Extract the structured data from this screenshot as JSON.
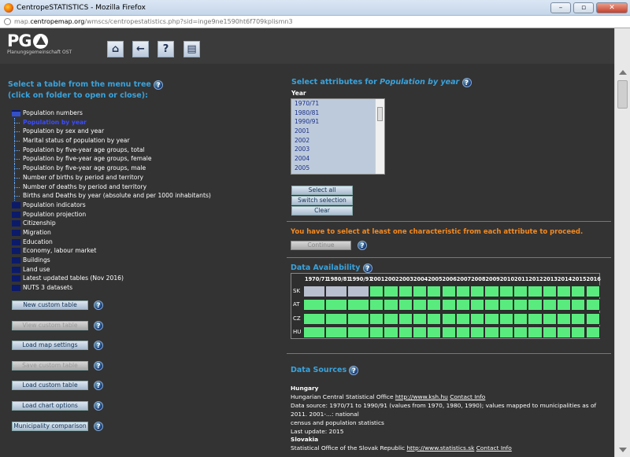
{
  "window": {
    "title": "CentropeSTATISTICS - Mozilla Firefox",
    "url_prefix": "map.",
    "url_domain": "centropemap.org",
    "url_path": "/wmscs/centropestatistics.php?sid=inge9ne1590ht6f709kplismn3"
  },
  "logo": {
    "text": "PG",
    "subtitle": "Planungsgemeinschaft OST"
  },
  "toolbar": {
    "home": "⌂",
    "back": "←",
    "help": "?",
    "window": "▤"
  },
  "left": {
    "heading1": "Select a table from the menu tree",
    "heading2": "(click on folder to open or close):",
    "tree": [
      {
        "label": "Population numbers",
        "type": "folder-open"
      },
      {
        "label": "Population by year",
        "type": "leaf",
        "selected": true
      },
      {
        "label": "Population by sex and year",
        "type": "leaf"
      },
      {
        "label": "Marital status of population by year",
        "type": "leaf"
      },
      {
        "label": "Population by five-year age groups, total",
        "type": "leaf"
      },
      {
        "label": "Population by five-year age groups, female",
        "type": "leaf"
      },
      {
        "label": "Population by five-year age groups, male",
        "type": "leaf"
      },
      {
        "label": "Number of births by period and territory",
        "type": "leaf"
      },
      {
        "label": "Number of deaths by period and territory",
        "type": "leaf"
      },
      {
        "label": "Births and Deaths by year (absolute and per 1000 inhabitants)",
        "type": "leaf"
      },
      {
        "label": "Population indicators",
        "type": "folder"
      },
      {
        "label": "Population projection",
        "type": "folder"
      },
      {
        "label": "Citizenship",
        "type": "folder"
      },
      {
        "label": "Migration",
        "type": "folder"
      },
      {
        "label": "Education",
        "type": "folder"
      },
      {
        "label": "Economy, labour market",
        "type": "folder"
      },
      {
        "label": "Buildings",
        "type": "folder"
      },
      {
        "label": "Land use",
        "type": "folder"
      },
      {
        "label": "Latest updated tables (Nov 2016)",
        "type": "folder"
      },
      {
        "label": "NUTS 3 datasets",
        "type": "folder"
      }
    ],
    "buttons": [
      {
        "label": "New custom table",
        "disabled": false
      },
      {
        "label": "View custom table",
        "disabled": true
      },
      {
        "label": "Load map settings",
        "disabled": false
      },
      {
        "label": "Save custom table",
        "disabled": true
      },
      {
        "label": "Load custom table",
        "disabled": false
      },
      {
        "label": "Load chart options",
        "disabled": false
      },
      {
        "label": "Municipality comparison",
        "disabled": false
      }
    ]
  },
  "right": {
    "heading_prefix": "Select attributes for ",
    "heading_table": "Population by year",
    "year_label": "Year",
    "years": [
      "1970/71",
      "1980/81",
      "1990/91",
      "2001",
      "2002",
      "2003",
      "2004",
      "2005"
    ],
    "select_all": "Select all",
    "switch_selection": "Switch selection",
    "clear": "Clear",
    "warning": "You have to select at least one characteristic from each attribute to proceed.",
    "continue": "Continue",
    "availability_heading": "Data Availability",
    "availability": {
      "columns": [
        "1970/71",
        "1980/81",
        "1990/91",
        "2001",
        "2002",
        "2003",
        "2004",
        "2005",
        "2006",
        "2007",
        "2008",
        "2009",
        "2010",
        "2011",
        "2012",
        "2013",
        "2014",
        "2015",
        "2016"
      ],
      "rows": [
        {
          "code": "SK",
          "missing": [
            0,
            1,
            2
          ]
        },
        {
          "code": "AT",
          "missing": []
        },
        {
          "code": "CZ",
          "missing": []
        },
        {
          "code": "HU",
          "missing": []
        }
      ],
      "color_available": "#5aeb7e",
      "color_missing": "#b8bfce"
    },
    "sources_heading": "Data Sources",
    "sources": [
      {
        "country": "Hungary",
        "office": "Hungarian Central Statistical Office",
        "link": "http://www.ksh.hu",
        "contact": "Contact Info",
        "line1": "Data source: 1970/71 to 1990/91 (values from 1970, 1980, 1990); values mapped to municipalities as of 2011. 2001-...: national",
        "line2": "census and population statistics",
        "update": "Last update: 2015"
      },
      {
        "country": "Slovakia",
        "office": "Statistical Office of the Slovak Republic",
        "link": "http://www.statistics.sk",
        "contact": "Contact Info"
      }
    ]
  },
  "help_glyph": "?"
}
